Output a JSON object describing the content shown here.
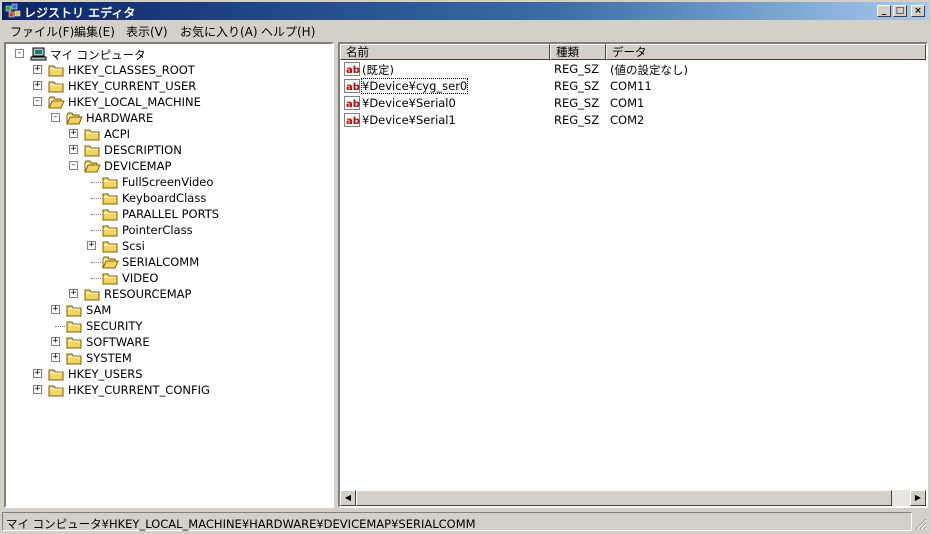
{
  "window": {
    "title": "レジストリ エディタ",
    "controls": {
      "minimize": "_",
      "maximize": "□",
      "close": "×"
    }
  },
  "menu": [
    "ファイル(F)",
    "編集(E)",
    "表示(V)",
    "お気に入り(A)",
    "ヘルプ(H)"
  ],
  "tree": {
    "root": "マイ コンピュータ",
    "nodes": [
      {
        "label": "HKEY_CLASSES_ROOT",
        "expander": "+"
      },
      {
        "label": "HKEY_CURRENT_USER",
        "expander": "+"
      },
      {
        "label": "HKEY_LOCAL_MACHINE",
        "expander": "-"
      },
      {
        "label": "HARDWARE",
        "expander": "-"
      },
      {
        "label": "ACPI",
        "expander": "+"
      },
      {
        "label": "DESCRIPTION",
        "expander": "+"
      },
      {
        "label": "DEVICEMAP",
        "expander": "-"
      },
      {
        "label": "FullScreenVideo",
        "expander": ""
      },
      {
        "label": "KeyboardClass",
        "expander": ""
      },
      {
        "label": "PARALLEL PORTS",
        "expander": ""
      },
      {
        "label": "PointerClass",
        "expander": ""
      },
      {
        "label": "Scsi",
        "expander": "+"
      },
      {
        "label": "SERIALCOMM",
        "expander": "",
        "selected": true
      },
      {
        "label": "VIDEO",
        "expander": ""
      },
      {
        "label": "RESOURCEMAP",
        "expander": "+"
      },
      {
        "label": "SAM",
        "expander": "+"
      },
      {
        "label": "SECURITY",
        "expander": ""
      },
      {
        "label": "SOFTWARE",
        "expander": "+"
      },
      {
        "label": "SYSTEM",
        "expander": "+"
      },
      {
        "label": "HKEY_USERS",
        "expander": "+"
      },
      {
        "label": "HKEY_CURRENT_CONFIG",
        "expander": "+"
      }
    ]
  },
  "list": {
    "columns": [
      "名前",
      "種類",
      "データ"
    ],
    "rows": [
      {
        "name": "(既定)",
        "type": "REG_SZ",
        "data": "(値の設定なし)"
      },
      {
        "name": "¥Device¥cyg_ser0",
        "type": "REG_SZ",
        "data": "COM11"
      },
      {
        "name": "¥Device¥Serial0",
        "type": "REG_SZ",
        "data": "COM1"
      },
      {
        "name": "¥Device¥Serial1",
        "type": "REG_SZ",
        "data": "COM2"
      }
    ],
    "value_icon_text": "ab"
  },
  "statusbar": {
    "path": "マイ コンピュータ¥HKEY_LOCAL_MACHINE¥HARDWARE¥DEVICEMAP¥SERIALCOMM"
  },
  "colors": {
    "titlebar_start": "#0a246a",
    "titlebar_end": "#a6caf0",
    "folder": "#f4d55b",
    "value_icon": "#c00000"
  }
}
